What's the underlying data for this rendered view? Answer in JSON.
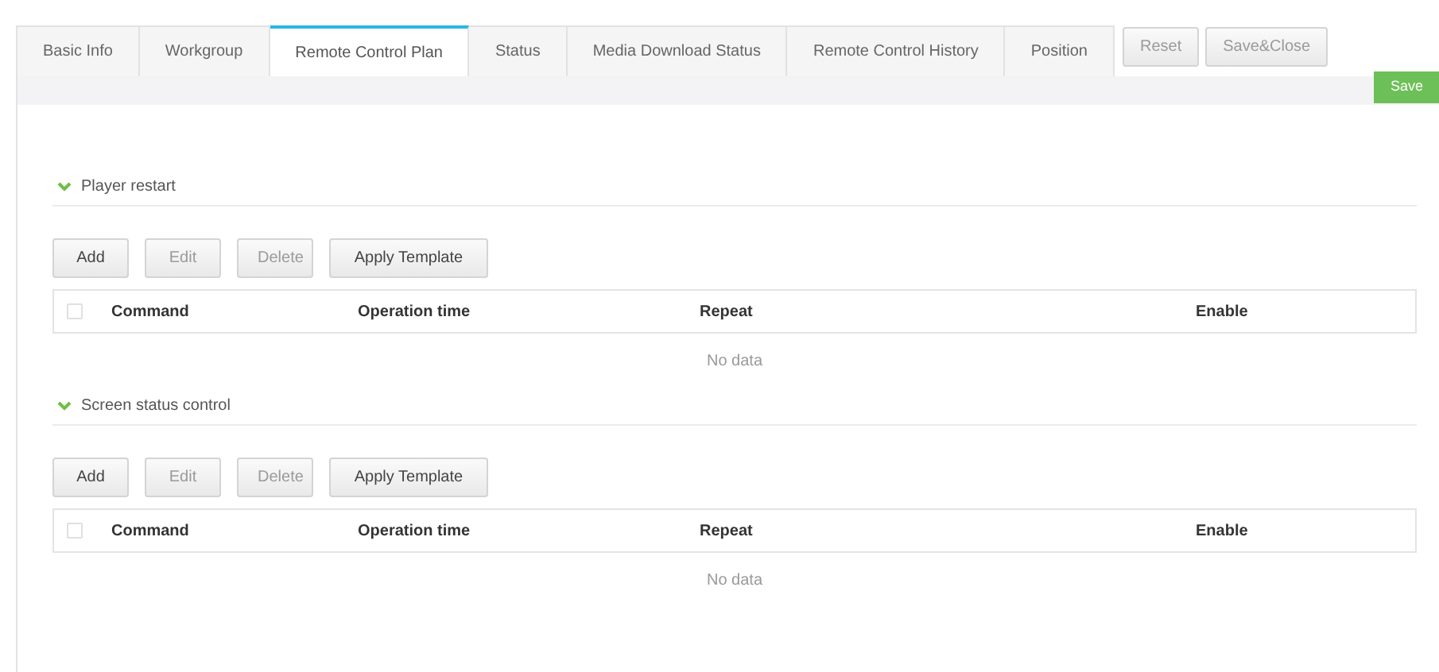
{
  "tabs": [
    {
      "label": "Basic Info",
      "selected": false
    },
    {
      "label": "Workgroup",
      "selected": false
    },
    {
      "label": "Remote Control Plan",
      "selected": true
    },
    {
      "label": "Status",
      "selected": false
    },
    {
      "label": "Media Download Status",
      "selected": false
    },
    {
      "label": "Remote Control History",
      "selected": false
    },
    {
      "label": "Position",
      "selected": false
    }
  ],
  "top_buttons": [
    {
      "label": "Reset",
      "disabled": true
    },
    {
      "label": "Save&Close",
      "disabled": true
    }
  ],
  "save_button": {
    "label": "Save"
  },
  "sections": [
    {
      "title": "Player restart",
      "expanded": true,
      "buttons": [
        {
          "label": "Add",
          "disabled": false
        },
        {
          "label": "Edit",
          "disabled": true
        },
        {
          "label": "Delete",
          "disabled": true
        },
        {
          "label": "Apply Template",
          "disabled": false
        }
      ],
      "table": {
        "select_all_checked": false,
        "columns": [
          "Command",
          "Operation time",
          "Repeat",
          "Enable"
        ],
        "empty_text": "No data"
      }
    },
    {
      "title": "Screen status control",
      "expanded": true,
      "buttons": [
        {
          "label": "Add",
          "disabled": false
        },
        {
          "label": "Edit",
          "disabled": true
        },
        {
          "label": "Delete",
          "disabled": true
        },
        {
          "label": "Apply Template",
          "disabled": false
        }
      ],
      "table": {
        "select_all_checked": false,
        "columns": [
          "Command",
          "Operation time",
          "Repeat",
          "Enable"
        ],
        "empty_text": "No data"
      }
    }
  ]
}
